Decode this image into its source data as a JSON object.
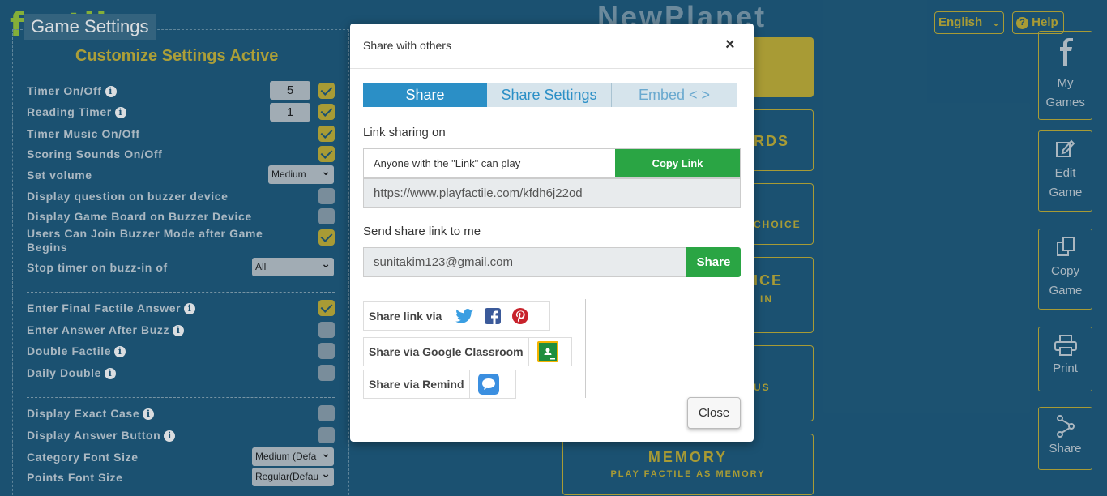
{
  "app": {
    "logo": "factile",
    "panel_title": "Game Settings",
    "panel_subtitle": "Customize Settings Active",
    "game_title": "NewPlanet",
    "language": "English",
    "help_label": "Help"
  },
  "settings": {
    "timer": {
      "label": "Timer On/Off",
      "value": "5",
      "checked": true
    },
    "reading_timer": {
      "label": "Reading Timer",
      "value": "1",
      "checked": true
    },
    "timer_music": {
      "label": "Timer Music On/Off",
      "checked": true
    },
    "scoring_sounds": {
      "label": "Scoring Sounds On/Off",
      "checked": true
    },
    "set_volume": {
      "label": "Set volume",
      "value": "Medium"
    },
    "display_question": {
      "label": "Display question on buzzer device",
      "checked": false
    },
    "display_board": {
      "label": "Display Game Board on Buzzer Device",
      "checked": false
    },
    "join_after": {
      "label": "Users Can Join Buzzer Mode after Game Begins",
      "checked": true
    },
    "stop_timer": {
      "label": "Stop timer on buzz-in of",
      "value": "All"
    },
    "final_answer": {
      "label": "Enter Final Factile Answer",
      "checked": true
    },
    "answer_after_buzz": {
      "label": "Enter Answer After Buzz",
      "checked": false
    },
    "double_factile": {
      "label": "Double Factile",
      "checked": false
    },
    "daily_double": {
      "label": "Daily Double",
      "checked": false
    },
    "exact_case": {
      "label": "Display Exact Case",
      "checked": false
    },
    "answer_button": {
      "label": "Display Answer Button",
      "checked": false
    },
    "category_font": {
      "label": "Category Font Size",
      "value": "Medium (Defa"
    },
    "points_font": {
      "label": "Points Font Size",
      "value": "Regular(Defau"
    }
  },
  "modes": {
    "frag1": "RDS",
    "frag2": "CHOICE",
    "frag3": "ICE",
    "frag4": "IN",
    "frag5": "US",
    "memory_title": "MEMORY",
    "memory_sub": "PLAY FACTILE AS MEMORY"
  },
  "sidebar": {
    "my_games": "My Games",
    "edit_game": "Edit Game",
    "copy_game": "Copy Game",
    "print": "Print",
    "share": "Share"
  },
  "modal": {
    "title": "Share with others",
    "close_x": "×",
    "tabs": [
      "Share",
      "Share Settings",
      "Embed < >"
    ],
    "link_sharing_label": "Link sharing on",
    "link_access": "Anyone with the \"Link\" can play",
    "copy_link": "Copy Link",
    "url": "https://www.playfactile.com/kfdh6j22od",
    "send_label": "Send share link to me",
    "email": "sunitakim123@gmail.com",
    "share_button": "Share",
    "share_via": "Share link via",
    "google_classroom": "Share via Google Classroom",
    "remind": "Share via Remind",
    "close_button": "Close"
  },
  "colors": {
    "background": "#1f5b7d",
    "gold": "#c5b237",
    "tab_active": "#2b8fc6",
    "green": "#2aa544"
  },
  "icons": [
    "info-icon",
    "facebook-icon",
    "edit-icon",
    "copy-icon",
    "print-icon",
    "share-icon",
    "twitter-icon",
    "pinterest-icon",
    "google-classroom-icon",
    "remind-icon",
    "close-icon",
    "help-icon"
  ]
}
